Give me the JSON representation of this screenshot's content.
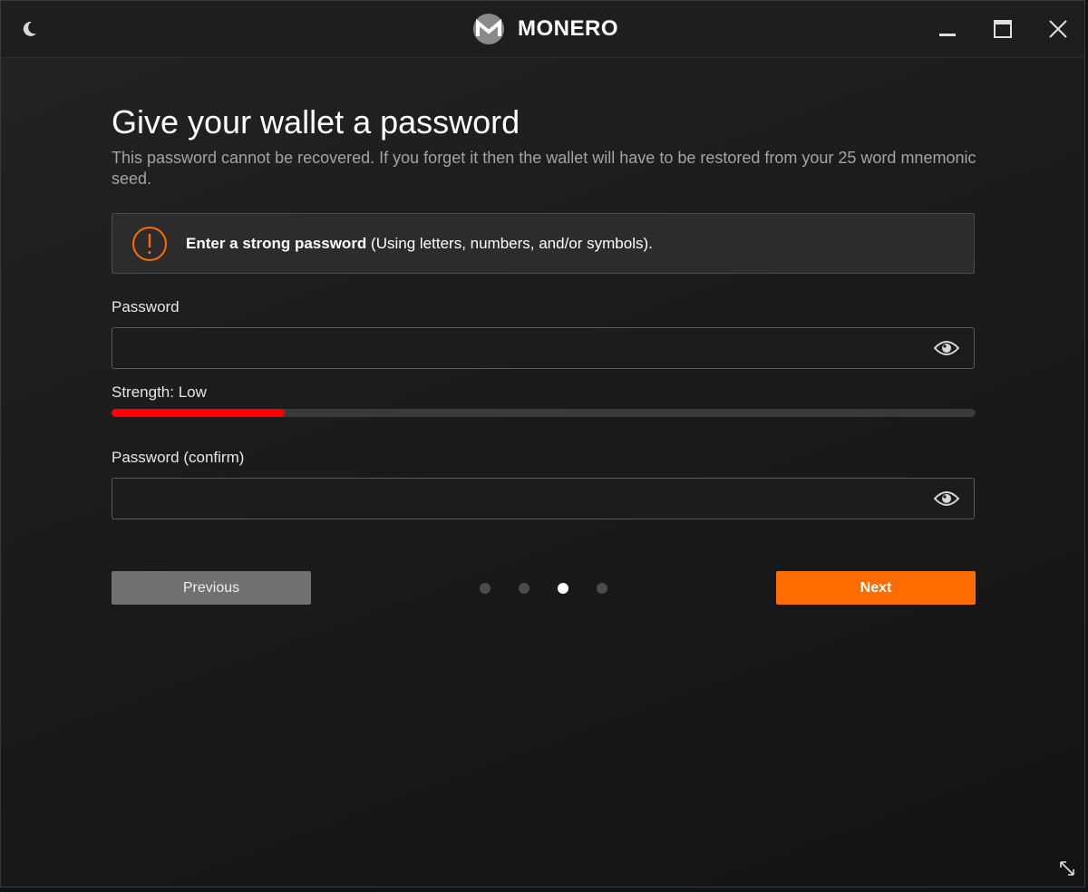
{
  "app": {
    "brand_name": "MONERO"
  },
  "page": {
    "title": "Give your wallet a password",
    "subtitle": "This password cannot be recovered. If you forget it then the wallet will have to be restored from your 25 word mnemonic seed."
  },
  "warning": {
    "bold_text": "Enter a strong password",
    "rest_text": " (Using letters, numbers, and/or symbols).",
    "accent_color": "#ff6c00"
  },
  "password": {
    "label": "Password",
    "value": ""
  },
  "strength": {
    "label": "Strength: Low",
    "fraction": 0.2,
    "color": "#ff0000"
  },
  "confirm": {
    "label": "Password (confirm)",
    "value": ""
  },
  "nav": {
    "previous_label": "Previous",
    "next_label": "Next",
    "step_count": 4,
    "active_step": 3
  },
  "icons": {
    "theme_toggle": "moon-icon",
    "brand": "monero-logo-icon",
    "minimize": "minimize-icon",
    "maximize": "maximize-icon",
    "close": "close-icon",
    "warning": "exclamation-icon",
    "show_password": "eye-icon",
    "resize": "resize-icon"
  }
}
